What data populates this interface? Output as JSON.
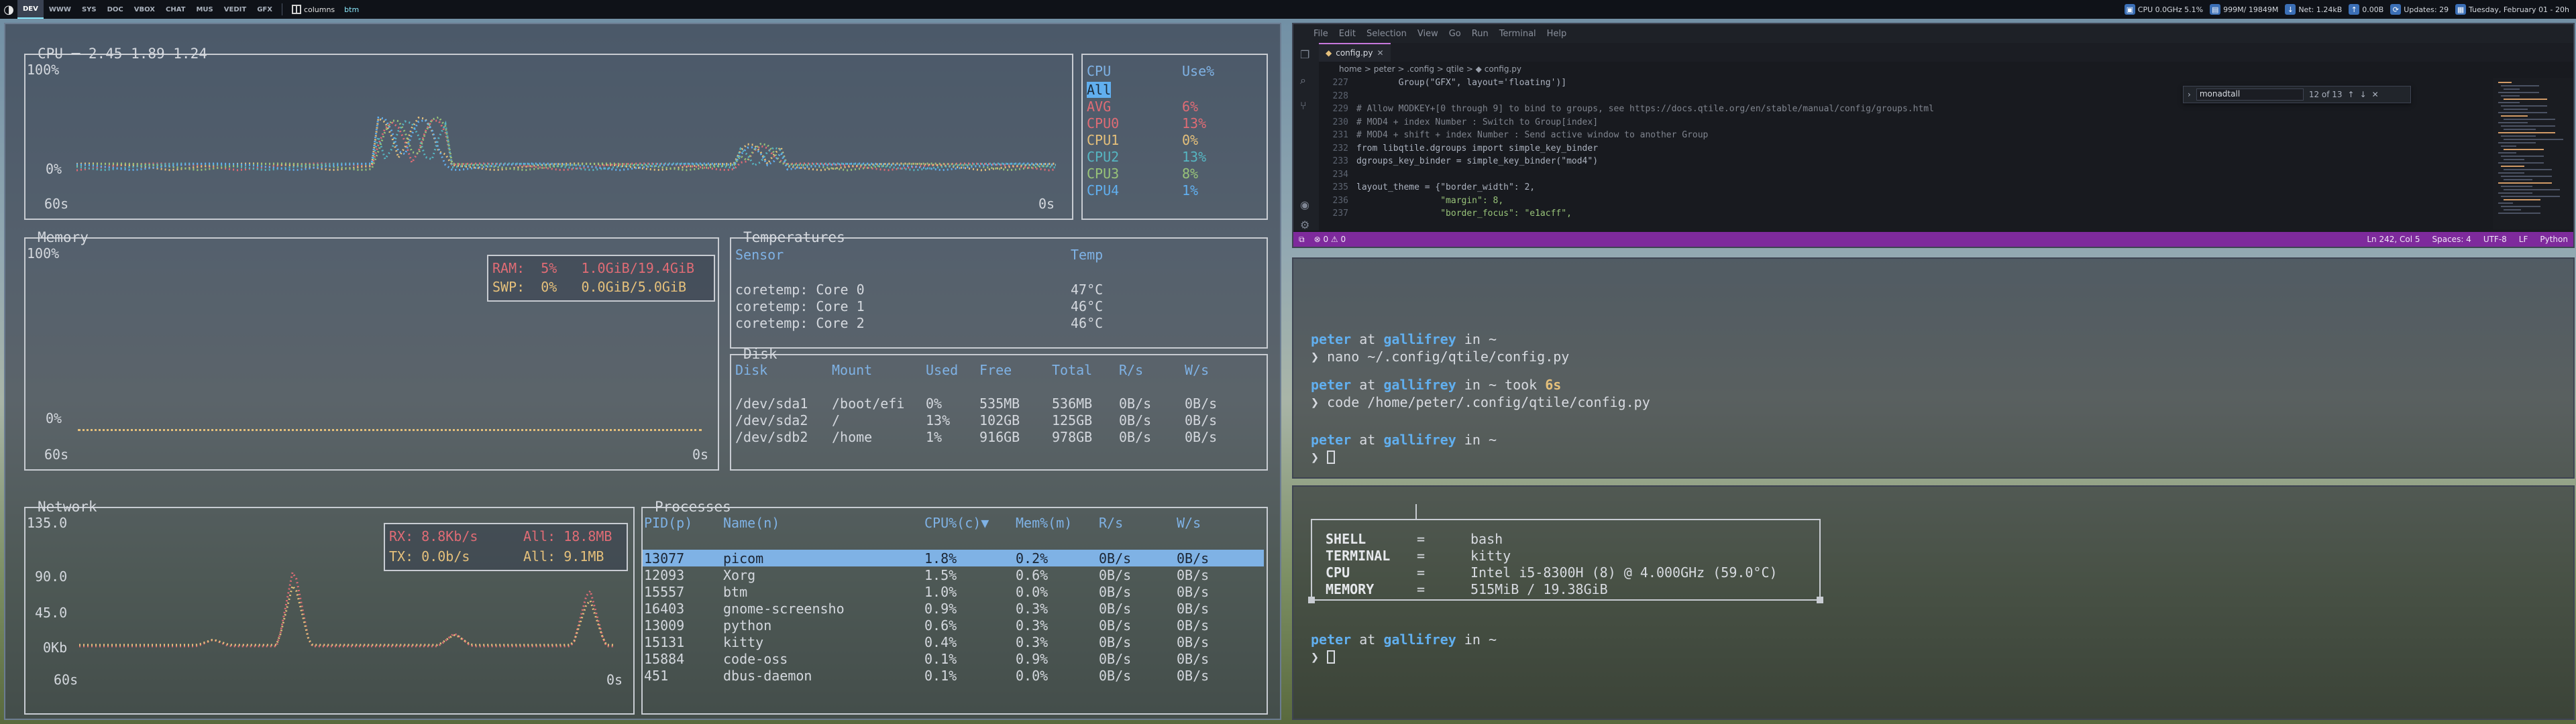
{
  "topbar": {
    "groups": [
      "DEV",
      "WWW",
      "SYS",
      "DOC",
      "VBOX",
      "CHAT",
      "MUS",
      "VEDIT",
      "GFX"
    ],
    "active_group": "DEV",
    "layout": "columns",
    "window_name": "btm",
    "cpu": "CPU 0.0GHz 5.1%",
    "mem": "999M/ 19849M",
    "net": "Net: 1.24kB",
    "net2": "0.00B",
    "updates": "Updates: 29",
    "date": "Tuesday, February 01 - 20h"
  },
  "btm": {
    "cpu": {
      "title": "CPU ─ 2.45 1.89 1.24",
      "y_top": "100%",
      "y_bottom": "0%",
      "x_left": "60s",
      "x_right": "0s",
      "legend_header": [
        "CPU",
        "Use%"
      ],
      "legend": [
        {
          "name": "All",
          "use": "",
          "color": "#c8ccd2"
        },
        {
          "name": "AVG",
          "use": "6%",
          "color": "#e06c75"
        },
        {
          "name": "CPU0",
          "use": "13%",
          "color": "#e06c75"
        },
        {
          "name": "CPU1",
          "use": "0%",
          "color": "#e5c07b"
        },
        {
          "name": "CPU2",
          "use": "13%",
          "color": "#56b6c2"
        },
        {
          "name": "CPU3",
          "use": "8%",
          "color": "#98c379"
        },
        {
          "name": "CPU4",
          "use": "1%",
          "color": "#61afef"
        }
      ]
    },
    "memory": {
      "title": "Memory",
      "y_top": "100%",
      "y_bottom": "0%",
      "x_left": "60s",
      "x_right": "0s",
      "ram": "RAM:  5%   1.0GiB/19.4GiB",
      "swp": "SWP:  0%   0.0GiB/5.0GiB"
    },
    "temps": {
      "title": "Temperatures",
      "headers": [
        "Sensor",
        "Temp"
      ],
      "rows": [
        [
          "coretemp: Core 0",
          "47°C"
        ],
        [
          "coretemp: Core 1",
          "46°C"
        ],
        [
          "coretemp: Core 2",
          "46°C"
        ]
      ]
    },
    "disk": {
      "title": "Disk",
      "headers": [
        "Disk",
        "Mount",
        "Used",
        "Free",
        "Total",
        "R/s",
        "W/s"
      ],
      "rows": [
        [
          "/dev/sda1",
          "/boot/efi",
          "0%",
          "535MB",
          "536MB",
          "0B/s",
          "0B/s"
        ],
        [
          "/dev/sda2",
          "/",
          "13%",
          "102GB",
          "125GB",
          "0B/s",
          "0B/s"
        ],
        [
          "/dev/sdb2",
          "/home",
          "1%",
          "916GB",
          "978GB",
          "0B/s",
          "0B/s"
        ]
      ]
    },
    "network": {
      "title": "Network",
      "y_ticks": [
        "135.0",
        "90.0",
        "45.0",
        "0Kb"
      ],
      "x_left": "60s",
      "x_right": "0s",
      "rx": "RX: 8.8Kb/s",
      "rx_all": "All: 18.8MB",
      "tx": "TX: 0.0b/s",
      "tx_all": "All: 9.1MB"
    },
    "processes": {
      "title": "Processes",
      "headers": [
        "PID(p)",
        "Name(n)",
        "CPU%(c)▼",
        "Mem%(m)",
        "R/s",
        "W/s"
      ],
      "rows": [
        [
          "13077",
          "picom",
          "1.8%",
          "0.2%",
          "0B/s",
          "0B/s"
        ],
        [
          "12093",
          "Xorg",
          "1.5%",
          "0.6%",
          "0B/s",
          "0B/s"
        ],
        [
          "15557",
          "btm",
          "1.0%",
          "0.0%",
          "0B/s",
          "0B/s"
        ],
        [
          "16403",
          "gnome-screensho",
          "0.9%",
          "0.3%",
          "0B/s",
          "0B/s"
        ],
        [
          "13009",
          "python",
          "0.6%",
          "0.3%",
          "0B/s",
          "0B/s"
        ],
        [
          "15131",
          "kitty",
          "0.4%",
          "0.3%",
          "0B/s",
          "0B/s"
        ],
        [
          "15884",
          "code-oss",
          "0.1%",
          "0.9%",
          "0B/s",
          "0B/s"
        ],
        [
          "451",
          "dbus-daemon",
          "0.1%",
          "0.0%",
          "0B/s",
          "0B/s"
        ]
      ]
    }
  },
  "vscode": {
    "menu": [
      "File",
      "Edit",
      "Selection",
      "View",
      "Go",
      "Run",
      "Terminal",
      "Help"
    ],
    "tab": "config.py",
    "breadcrumb": "home > peter > .config > qtile > ◆ config.py",
    "find_value": "monadtall",
    "find_count": "12 of 13",
    "lines": [
      {
        "n": "227",
        "t": "        Group(\"GFX\", layout='floating')]",
        "c": "#abb2bf"
      },
      {
        "n": "228",
        "t": "",
        "c": "#abb2bf"
      },
      {
        "n": "229",
        "t": "# Allow MODKEY+[0 through 9] to bind to groups, see https://docs.qtile.org/en/stable/manual/config/groups.html",
        "c": "#7f848e"
      },
      {
        "n": "230",
        "t": "# MOD4 + index Number : Switch to Group[index]",
        "c": "#7f848e"
      },
      {
        "n": "231",
        "t": "# MOD4 + shift + index Number : Send active window to another Group",
        "c": "#7f848e"
      },
      {
        "n": "232",
        "t": "from libqtile.dgroups import simple_key_binder",
        "c": "#abb2bf"
      },
      {
        "n": "233",
        "t": "dgroups_key_binder = simple_key_binder(\"mod4\")",
        "c": "#abb2bf"
      },
      {
        "n": "234",
        "t": "",
        "c": "#abb2bf"
      },
      {
        "n": "235",
        "t": "layout_theme = {\"border_width\": 2,",
        "c": "#abb2bf"
      },
      {
        "n": "236",
        "t": "                \"margin\": 8,",
        "c": "#98c379"
      },
      {
        "n": "237",
        "t": "                \"border_focus\": \"e1acff\",",
        "c": "#98c379"
      }
    ],
    "status_left": "⊗ 0 ⚠ 0",
    "status_right": [
      "Ln 242, Col 5",
      "Spaces: 4",
      "UTF-8",
      "LF",
      "Python"
    ]
  },
  "term1": {
    "user": "peter",
    "host": "gallifrey",
    "dir": "~",
    "cmd1": "nano ~/.config/qtile/config.py",
    "took": "took",
    "took_time": "6s",
    "cmd2": "code /home/peter/.config/qtile/config.py"
  },
  "term2": {
    "info": [
      {
        "k": "SHELL",
        "v": "bash"
      },
      {
        "k": "TERMINAL",
        "v": "kitty"
      },
      {
        "k": "CPU",
        "v": "Intel i5-8300H (8) @ 4.000GHz (59.0°C)"
      },
      {
        "k": "MEMORY",
        "v": "515MiB / 19.38GiB"
      }
    ],
    "user": "peter",
    "host": "gallifrey",
    "dir": "~"
  }
}
